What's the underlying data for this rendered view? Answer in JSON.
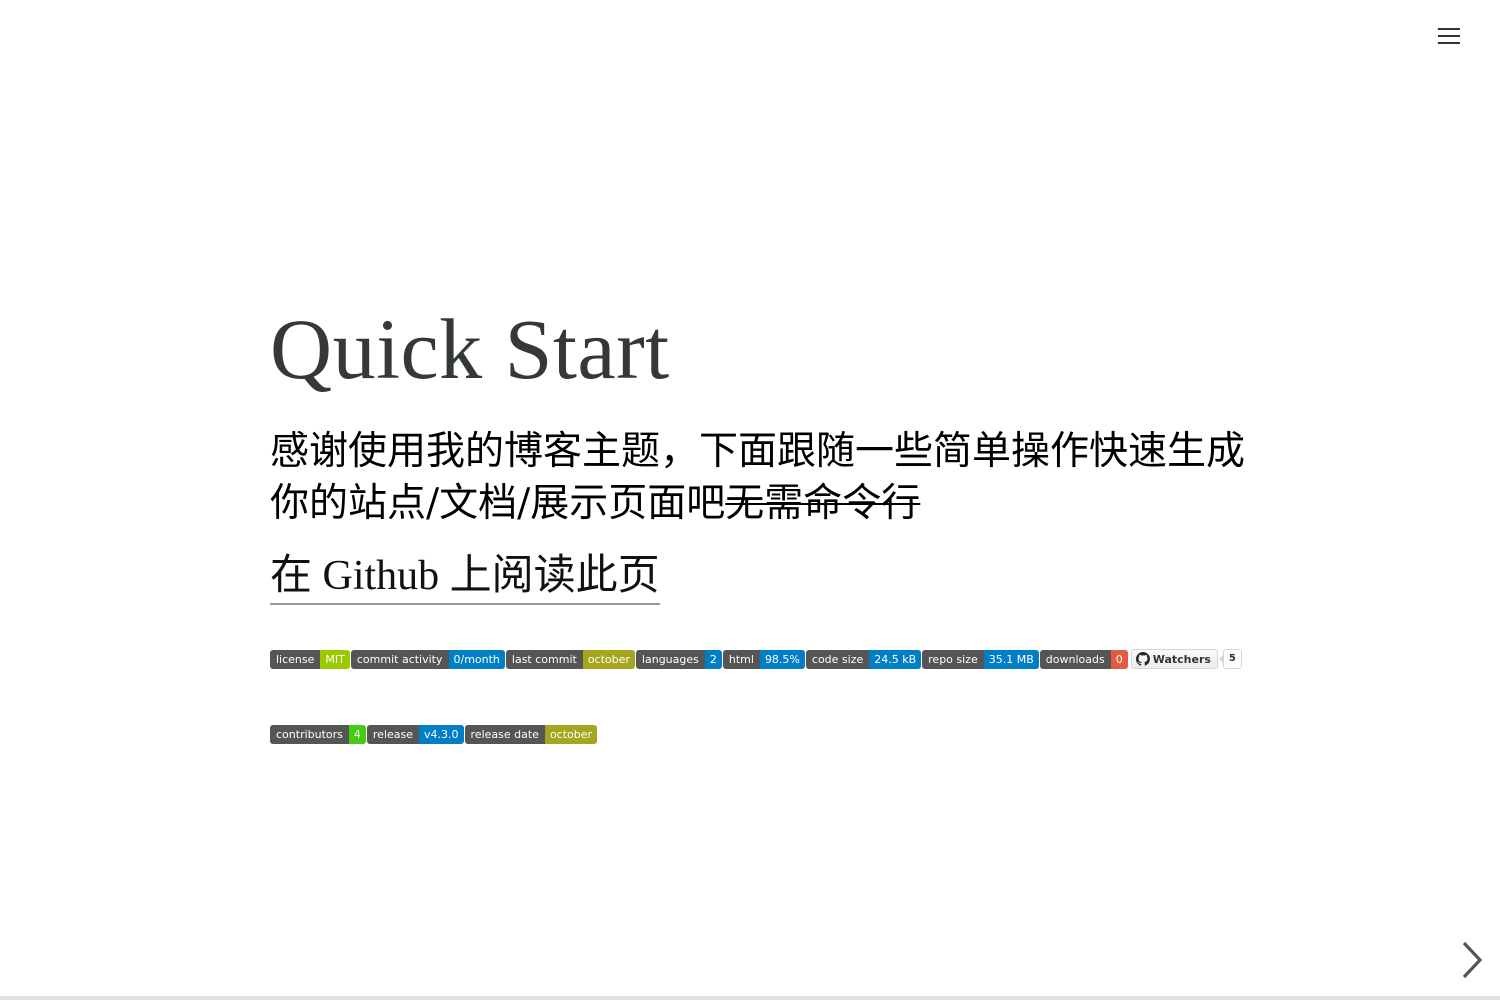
{
  "menu": {
    "icon": "hamburger-menu-icon"
  },
  "slide": {
    "title": "Quick Start",
    "subtitle_main": "感谢使用我的博客主题，下面跟随一些简单操作快速生成你的站点/文档/展示页面吧",
    "subtitle_struck": "无需命令行",
    "github_link": "在 Github 上阅读此页"
  },
  "badges_row1": [
    {
      "label": "license",
      "value": "MIT",
      "color": "#97ca00"
    },
    {
      "label": "commit activity",
      "value": "0/month",
      "color": "#007ec6"
    },
    {
      "label": "last commit",
      "value": "october",
      "color": "#a4a61d"
    },
    {
      "label": "languages",
      "value": "2",
      "color": "#007ec6"
    },
    {
      "label": "html",
      "value": "98.5%",
      "color": "#007ec6"
    },
    {
      "label": "code size",
      "value": "24.5 kB",
      "color": "#007ec6"
    },
    {
      "label": "repo size",
      "value": "35.1 MB",
      "color": "#007ec6"
    },
    {
      "label": "downloads",
      "value": "0",
      "color": "#e05d44"
    }
  ],
  "watchers": {
    "label": "Watchers",
    "count": "5",
    "icon": "github-icon"
  },
  "badges_row2": [
    {
      "label": "contributors",
      "value": "4",
      "color": "#4c1"
    },
    {
      "label": "release",
      "value": "v4.3.0",
      "color": "#007ec6"
    },
    {
      "label": "release date",
      "value": "october",
      "color": "#a4a61d"
    }
  ],
  "navigation": {
    "next_icon": "chevron-right-icon"
  },
  "progress": {
    "fraction": 0.0,
    "color": "#42b983"
  }
}
